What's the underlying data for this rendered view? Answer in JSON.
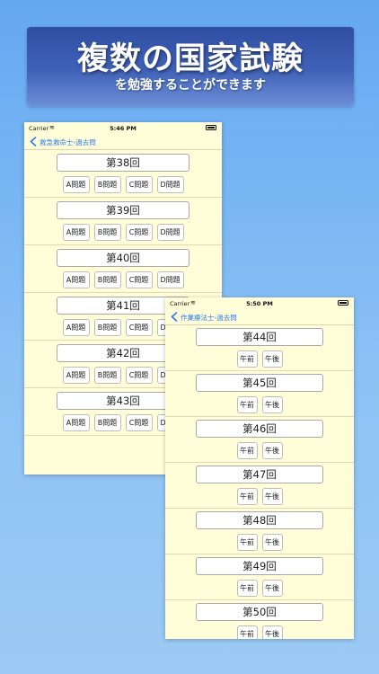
{
  "banner": {
    "title": "複数の国家試験",
    "subtitle": "を勉強することができます"
  },
  "phone_a": {
    "carrier": "Carrier",
    "time": "5:46 PM",
    "nav_title": "救急救命士-過去問",
    "sections": [
      {
        "title": "第38回",
        "buttons": [
          "A問題",
          "B問題",
          "C問題",
          "D問題"
        ]
      },
      {
        "title": "第39回",
        "buttons": [
          "A問題",
          "B問題",
          "C問題",
          "D問題"
        ]
      },
      {
        "title": "第40回",
        "buttons": [
          "A問題",
          "B問題",
          "C問題",
          "D問題"
        ]
      },
      {
        "title": "第41回",
        "buttons": [
          "A問題",
          "B問題",
          "C問題",
          "D問題"
        ]
      },
      {
        "title": "第42回",
        "buttons": [
          "A問題",
          "B問題",
          "C問題",
          "D問題"
        ]
      },
      {
        "title": "第43回",
        "buttons": [
          "A問題",
          "B問題",
          "C問題",
          "D問題"
        ]
      }
    ]
  },
  "phone_b": {
    "carrier": "Carrier",
    "time": "5:50 PM",
    "nav_title": "作業療法士-過去問",
    "sections": [
      {
        "title": "第44回",
        "buttons": [
          "午前",
          "午後"
        ]
      },
      {
        "title": "第45回",
        "buttons": [
          "午前",
          "午後"
        ]
      },
      {
        "title": "第46回",
        "buttons": [
          "午前",
          "午後"
        ]
      },
      {
        "title": "第47回",
        "buttons": [
          "午前",
          "午後"
        ]
      },
      {
        "title": "第48回",
        "buttons": [
          "午前",
          "午後"
        ]
      },
      {
        "title": "第49回",
        "buttons": [
          "午前",
          "午後"
        ]
      },
      {
        "title": "第50回",
        "buttons": [
          "午前",
          "午後"
        ]
      }
    ]
  },
  "colors": {
    "accent": "#2a7bf1",
    "panel_bg": "#fffed8"
  }
}
